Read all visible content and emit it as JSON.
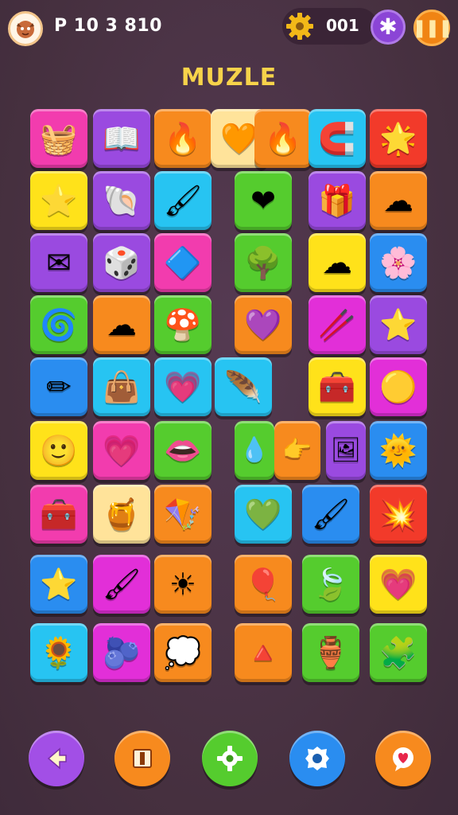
{
  "header": {
    "avatar_icon": "dragon-avatar-icon",
    "score": "P 10 3 810",
    "settings_icon": "gear-icon",
    "coins": "001",
    "plus_icon": "asterisk-icon",
    "pause_icon": "pause-icon"
  },
  "title": "MUZLE",
  "colors": {
    "pink": "#f23cae",
    "purple": "#9a4ae0",
    "orange": "#f78a1e",
    "cream": "#ffe39a",
    "cyan": "#27c4f2",
    "red": "#f23a2a",
    "yellow": "#ffe21a",
    "green": "#55cc2e",
    "blue": "#2a8df0",
    "magenta": "#e22fd8",
    "title": "#f7d34a",
    "background": "#4a3247"
  },
  "tiles": [
    {
      "color": "pink",
      "icon": "treasure-chest-icon",
      "glyph": "🧺"
    },
    {
      "color": "purple",
      "icon": "open-book-icon",
      "glyph": "📖"
    },
    {
      "color": "orange",
      "icon": "flame-heart-icon",
      "glyph": "🔥"
    },
    {
      "color": "cream",
      "icon": "heart-icon",
      "glyph": "🧡"
    },
    {
      "color": "orange",
      "icon": "flame-icon",
      "glyph": "🔥"
    },
    {
      "color": "cyan",
      "icon": "horseshoe-icon",
      "glyph": "🧲"
    },
    {
      "color": "red",
      "icon": "sun-star-icon",
      "glyph": "🌟"
    },
    {
      "color": "yellow",
      "icon": "star-icon",
      "glyph": "⭐"
    },
    {
      "color": "purple",
      "icon": "shell-icon",
      "glyph": "🐚"
    },
    {
      "color": "cyan",
      "icon": "rocket-icon",
      "glyph": "🖌"
    },
    {
      "color": "green",
      "icon": "heart-icon",
      "glyph": "❤"
    },
    {
      "color": "purple",
      "icon": "box-icon",
      "glyph": "🎁"
    },
    {
      "color": "orange",
      "icon": "cloud-icon",
      "glyph": "☁"
    },
    {
      "color": "purple",
      "icon": "envelope-icon",
      "glyph": "✉"
    },
    {
      "color": "purple",
      "icon": "dice-icon",
      "glyph": "🎲"
    },
    {
      "color": "pink",
      "icon": "square-gem-icon",
      "glyph": "🔷"
    },
    {
      "color": "green",
      "icon": "bush-icon",
      "glyph": "🌳"
    },
    {
      "color": "yellow",
      "icon": "cloud-icon",
      "glyph": "☁"
    },
    {
      "color": "blue",
      "icon": "flower-icon",
      "glyph": "🌸"
    },
    {
      "color": "green",
      "icon": "swirl-icon",
      "glyph": "🌀"
    },
    {
      "color": "orange",
      "icon": "cloud-icon",
      "glyph": "☁"
    },
    {
      "color": "green",
      "icon": "mushroom-icon",
      "glyph": "🍄"
    },
    {
      "color": "orange",
      "icon": "spiral-heart-icon",
      "glyph": "💜"
    },
    {
      "color": "magenta",
      "icon": "stick-icon",
      "glyph": "🥢"
    },
    {
      "color": "purple",
      "icon": "star-icon",
      "glyph": "⭐"
    },
    {
      "color": "blue",
      "icon": "pencil-icon",
      "glyph": "✏"
    },
    {
      "color": "cyan",
      "icon": "bag-icon",
      "glyph": "👜"
    },
    {
      "color": "cyan",
      "icon": "heart-icon",
      "glyph": "💗"
    },
    {
      "color": "cyan",
      "icon": "feather-icon",
      "glyph": "🪶"
    },
    {
      "color": "yellow",
      "icon": "toolbox-icon",
      "glyph": "🧰"
    },
    {
      "color": "magenta",
      "icon": "blob-icon",
      "glyph": "🟡"
    },
    {
      "color": "yellow",
      "icon": "face-icon",
      "glyph": "🙂"
    },
    {
      "color": "pink",
      "icon": "heart-icon",
      "glyph": "💗"
    },
    {
      "color": "green",
      "icon": "lips-icon",
      "glyph": "👄"
    },
    {
      "color": "green",
      "icon": "drop-icon",
      "glyph": "💧"
    },
    {
      "color": "orange",
      "icon": "pointing-hand-icon",
      "glyph": "👉"
    },
    {
      "color": "purple",
      "icon": "picture-icon",
      "glyph": "🖼"
    },
    {
      "color": "blue",
      "icon": "sun-icon",
      "glyph": "🌞"
    },
    {
      "color": "pink",
      "icon": "toolbox-icon",
      "glyph": "🧰"
    },
    {
      "color": "cream",
      "icon": "pot-icon",
      "glyph": "🍯"
    },
    {
      "color": "orange",
      "icon": "kite-icon",
      "glyph": "🪁"
    },
    {
      "color": "cyan",
      "icon": "heart-icon",
      "glyph": "💚"
    },
    {
      "color": "blue",
      "icon": "paintbrush-icon",
      "glyph": "🖌"
    },
    {
      "color": "red",
      "icon": "starburst-icon",
      "glyph": "💥"
    },
    {
      "color": "blue",
      "icon": "star-icon",
      "glyph": "⭐"
    },
    {
      "color": "magenta",
      "icon": "brush-icon",
      "glyph": "🖌"
    },
    {
      "color": "orange",
      "icon": "sun-icon",
      "glyph": "☀"
    },
    {
      "color": "orange",
      "icon": "balloon-icon",
      "glyph": "🎈"
    },
    {
      "color": "green",
      "icon": "leaf-icon",
      "glyph": "🍃"
    },
    {
      "color": "yellow",
      "icon": "heart-icon",
      "glyph": "💗"
    },
    {
      "color": "cyan",
      "icon": "sunflower-icon",
      "glyph": "🌻"
    },
    {
      "color": "magenta",
      "icon": "bug-icon",
      "glyph": "🫐"
    },
    {
      "color": "orange",
      "icon": "cloud-icon",
      "glyph": "💭"
    },
    {
      "color": "orange",
      "icon": "cone-icon",
      "glyph": "🔺"
    },
    {
      "color": "green",
      "icon": "jar-icon",
      "glyph": "🏺"
    },
    {
      "color": "green",
      "icon": "puzzle-piece-icon",
      "glyph": "🧩"
    }
  ],
  "footer": {
    "buttons": [
      {
        "icon": "back-arrow-icon",
        "color": "#a24fe6"
      },
      {
        "icon": "stop-icon",
        "color": "#f78a1e"
      },
      {
        "icon": "gear-icon",
        "color": "#55cc2e"
      },
      {
        "icon": "settings-badge-icon",
        "color": "#2a8df0"
      },
      {
        "icon": "heart-bubble-icon",
        "color": "#f78a1e"
      }
    ]
  }
}
